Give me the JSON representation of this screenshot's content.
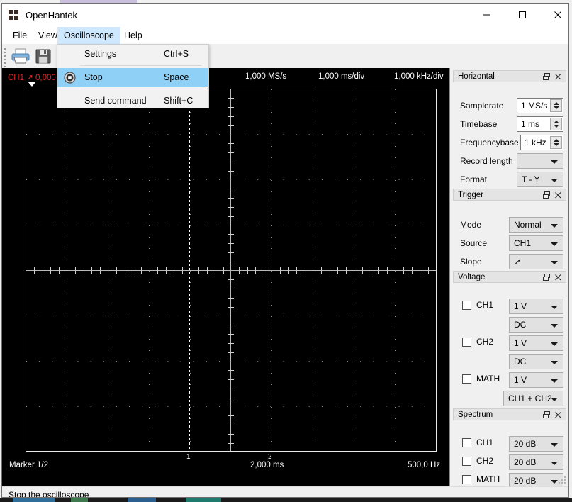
{
  "window": {
    "title": "OpenHantek",
    "controls": {
      "minimize": "minimize-icon",
      "maximize": "maximize-icon",
      "close": "close-icon"
    }
  },
  "menubar": {
    "items": [
      {
        "label": "File",
        "active": false
      },
      {
        "label": "View",
        "active": false
      },
      {
        "label": "Oscilloscope",
        "active": true
      },
      {
        "label": "Help",
        "active": false
      }
    ]
  },
  "toolbar": {
    "buttons": [
      {
        "name": "print-button",
        "icon": "printer-icon"
      },
      {
        "name": "save-button",
        "icon": "floppy-disk-icon"
      }
    ]
  },
  "dropdown": {
    "owner": "Oscilloscope",
    "items": [
      {
        "label": "Settings",
        "shortcut": "Ctrl+S",
        "selected": false,
        "icon": null
      },
      {
        "label": "Stop",
        "shortcut": "Space",
        "selected": true,
        "icon": "stop-record-icon"
      },
      {
        "label": "Send command",
        "shortcut": "Shift+C",
        "selected": false,
        "icon": null
      }
    ]
  },
  "scope": {
    "header": {
      "channel_marker": "CH1 ↗ 0,000",
      "samplerate": "1,000 MS/s",
      "timebase": "1,000 ms/div",
      "frequencybase": "1,000 kHz/div"
    },
    "footer": {
      "marker": "Marker 1/2",
      "time": "2,000 ms",
      "frequency": "500,0 Hz"
    },
    "markers": [
      {
        "id": "1",
        "label": "1"
      },
      {
        "id": "2",
        "label": "2"
      }
    ],
    "background": "#000000",
    "grid_color": "#8b8b8b",
    "border_color": "#e8e8e8"
  },
  "dock": {
    "panels": [
      {
        "title": "Horizontal",
        "rows": [
          {
            "label": "Samplerate",
            "control": "spin",
            "value": "1 MS/s"
          },
          {
            "label": "Timebase",
            "control": "spin",
            "value": "1 ms"
          },
          {
            "label": "Frequencybase",
            "control": "spin",
            "value": "1 kHz"
          },
          {
            "label": "Record length",
            "control": "combo",
            "value": "",
            "disabled": true
          },
          {
            "label": "Format",
            "control": "combo",
            "value": "T - Y"
          }
        ]
      },
      {
        "title": "Trigger",
        "rows": [
          {
            "label": "Mode",
            "control": "combo",
            "value": "Normal"
          },
          {
            "label": "Source",
            "control": "combo",
            "value": "CH1"
          },
          {
            "label": "Slope",
            "control": "combo",
            "value": "↗"
          }
        ]
      },
      {
        "title": "Voltage",
        "channels": [
          {
            "label": "CH1",
            "checked": false,
            "gain": "1 V",
            "coupling": "DC"
          },
          {
            "label": "CH2",
            "checked": false,
            "gain": "1 V",
            "coupling": "DC"
          },
          {
            "label": "MATH",
            "checked": false,
            "gain": "1 V",
            "coupling": "CH1 + CH2"
          }
        ]
      },
      {
        "title": "Spectrum",
        "channels": [
          {
            "label": "CH1",
            "checked": false,
            "magnitude": "20 dB"
          },
          {
            "label": "CH2",
            "checked": false,
            "magnitude": "20 dB"
          },
          {
            "label": "MATH",
            "checked": false,
            "magnitude": "20 dB"
          }
        ]
      }
    ],
    "header_buttons": {
      "float": "float-icon",
      "close": "close-icon"
    }
  },
  "statusbar": {
    "text": "Stop the oscilloscope"
  }
}
